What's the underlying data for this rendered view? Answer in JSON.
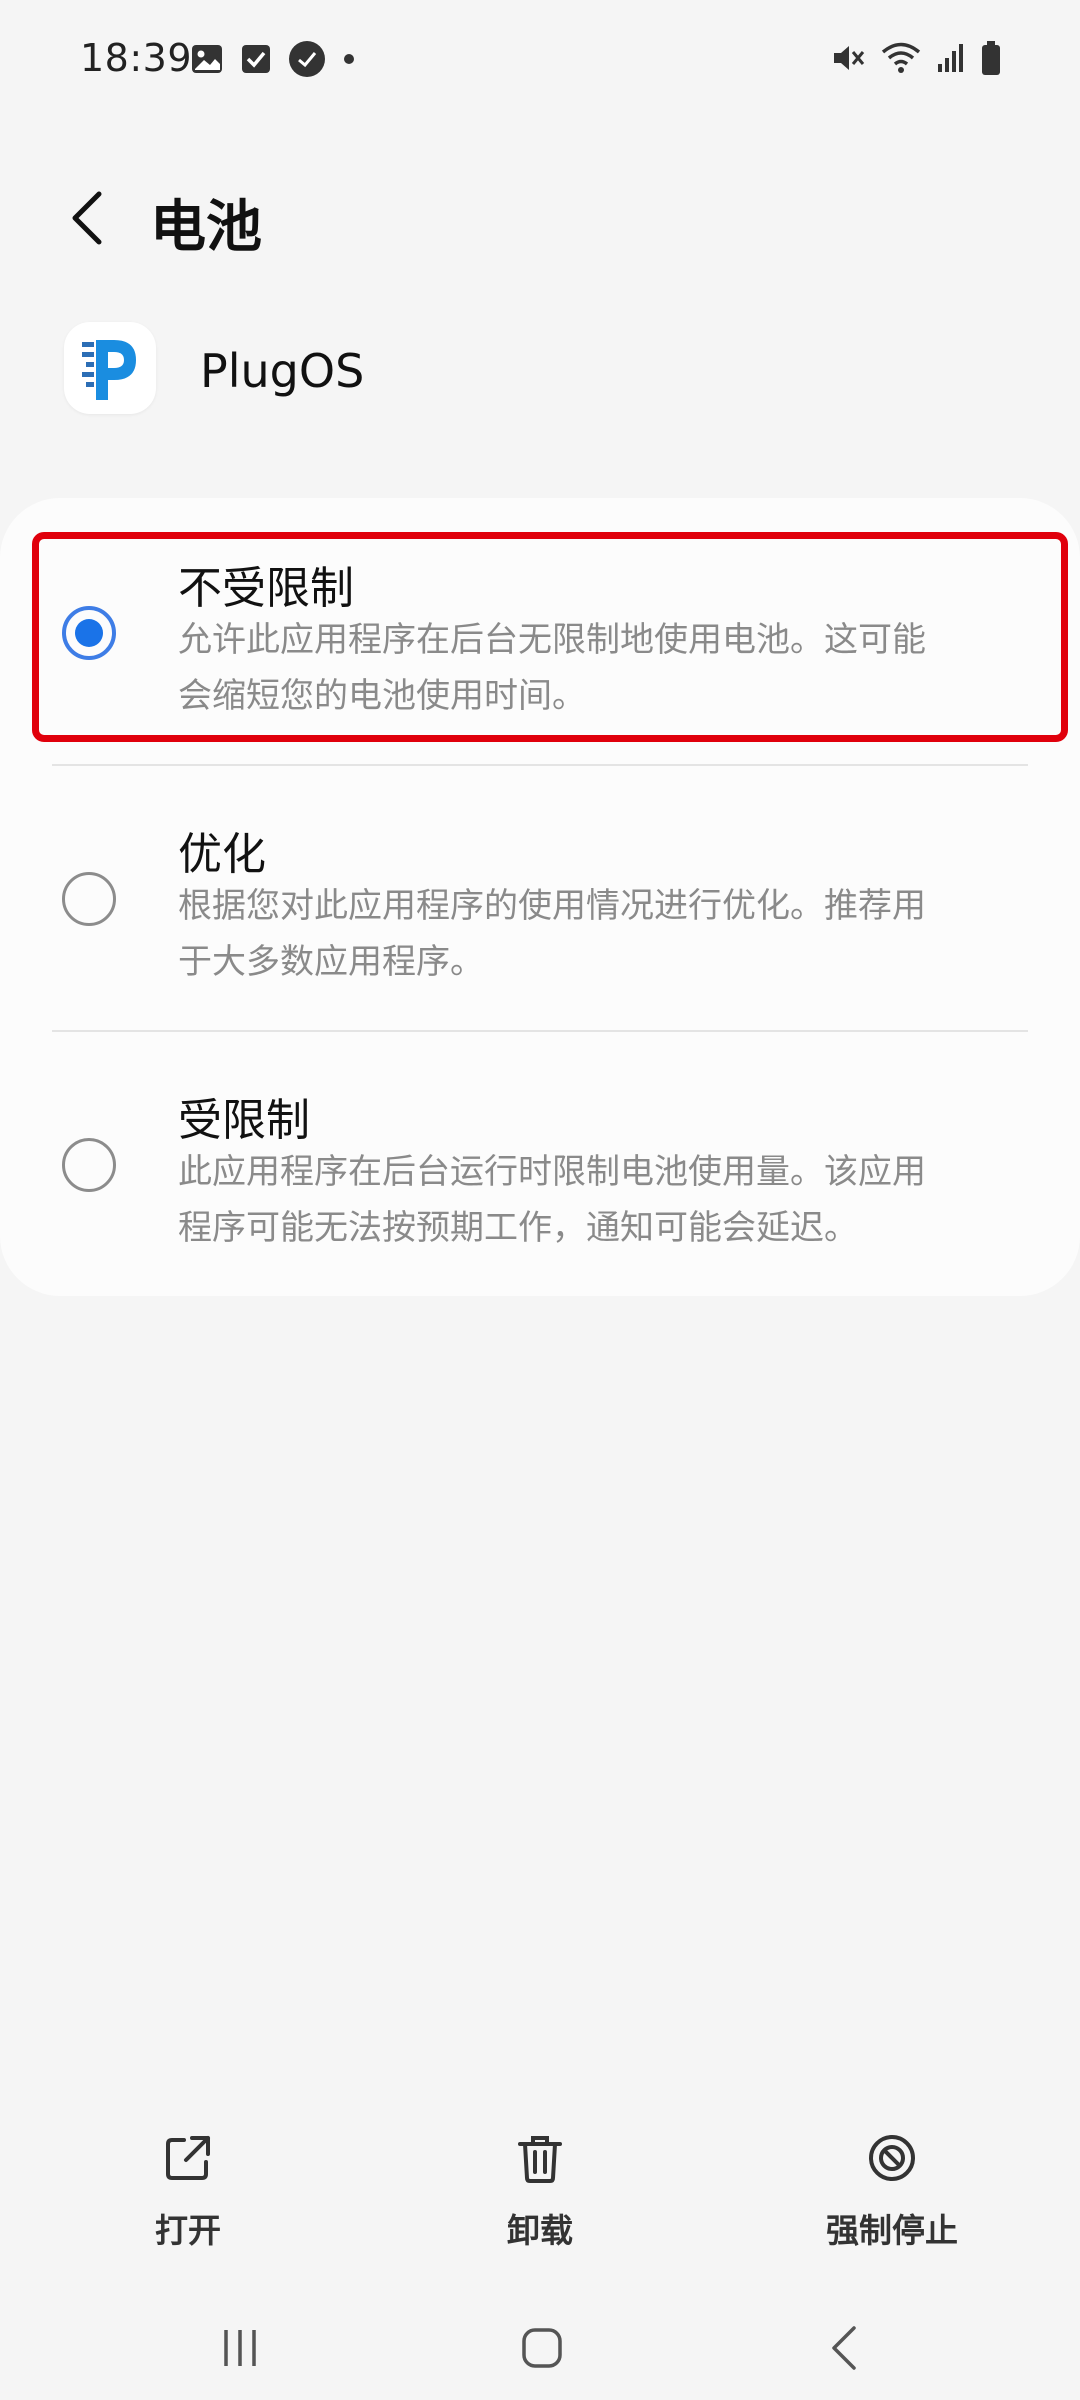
{
  "status_bar": {
    "time": "18:39",
    "left_icons": [
      "gallery-icon",
      "checkbox-icon",
      "app-status-icon",
      "dot-icon"
    ],
    "right_icons": [
      "mute-icon",
      "wifi-icon",
      "signal-icon",
      "battery-icon"
    ]
  },
  "header": {
    "title": "电池",
    "back_icon": "chevron-left-icon"
  },
  "app": {
    "name": "PlugOS",
    "icon": "plugos-logo-icon"
  },
  "options": [
    {
      "title": "不受限制",
      "description": "允许此应用程序在后台无限制地使用电池。这可能会缩短您的电池使用时间。",
      "selected": true
    },
    {
      "title": "优化",
      "description": "根据您对此应用程序的使用情况进行优化。推荐用于大多数应用程序。",
      "selected": false
    },
    {
      "title": "受限制",
      "description": "此应用程序在后台运行时限制电池使用量。该应用程序可能无法按预期工作，通知可能会延迟。",
      "selected": false
    }
  ],
  "colors": {
    "accent": "#1a73e8",
    "highlight": "#e0000c",
    "background": "#f5f5f5",
    "card": "#fcfcfc"
  },
  "bottom_actions": [
    {
      "label": "打开",
      "icon": "open-external-icon"
    },
    {
      "label": "卸载",
      "icon": "trash-icon"
    },
    {
      "label": "强制停止",
      "icon": "stop-circle-icon"
    }
  ],
  "nav_bar": [
    "recents-icon",
    "home-icon",
    "back-icon"
  ]
}
